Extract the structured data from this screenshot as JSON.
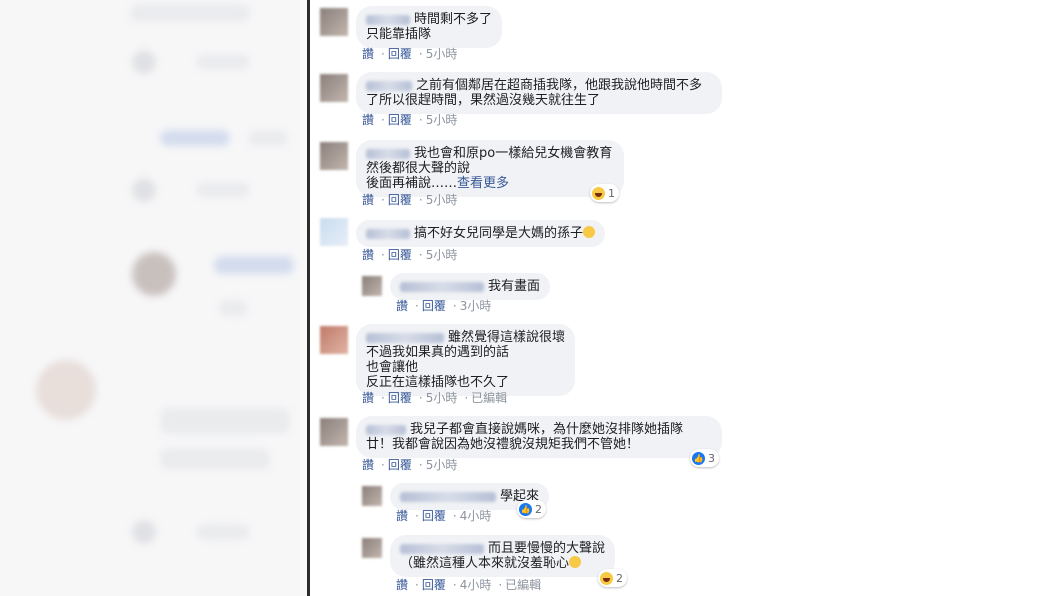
{
  "comments": [
    {
      "text_line1": "時間剩不多了",
      "text_rest": "只能靠插隊",
      "reply": "讚",
      "respond": "回覆",
      "time": "5小時"
    },
    {
      "text_line1": "之前有個鄰居在超商插我隊，他跟我說他時間不多",
      "text_rest": "了所以很趕時間，果然過沒幾天就往生了",
      "reply": "讚",
      "respond": "回覆",
      "time": "5小時"
    },
    {
      "text_line1": "我也會和原po一樣給兒女機會教育",
      "text_rest": "然後都很大聲的說\n後面再補說……",
      "see_more": "查看更多",
      "reaction_count": "1",
      "reply": "讚",
      "respond": "回覆",
      "time": "5小時"
    },
    {
      "text_line1": "搞不好女兒同學是大媽的孫子",
      "reply": "讚",
      "respond": "回覆",
      "time": "5小時"
    },
    {
      "text_line1": "我有畫面",
      "reply": "讚",
      "respond": "回覆",
      "time": "3小時"
    },
    {
      "text_line1": "雖然覺得這樣說很壞",
      "text_rest": "不過我如果真的遇到的話\n也會讓他\n反正在這樣插隊也不久了",
      "reply": "讚",
      "respond": "回覆",
      "time": "5小時",
      "edited": "已編輯"
    },
    {
      "text_line1": "我兒子都會直接說媽咪，為什麼她沒排隊她插隊",
      "text_rest": "廿！我都會說因為她沒禮貌沒規矩我們不管她！",
      "reaction_count": "3",
      "reply": "讚",
      "respond": "回覆",
      "time": "5小時"
    },
    {
      "text_line1": "學起來",
      "reaction_count": "2",
      "reply": "讚",
      "respond": "回覆",
      "time": "4小時"
    },
    {
      "text_line1": "而且要慢慢的大聲說",
      "text_rest": "（雖然這種人本來就沒羞恥心",
      "reaction_count": "2",
      "reply": "讚",
      "respond": "回覆",
      "time": "4小時",
      "edited": "已編輯"
    }
  ],
  "colors": {
    "link": "#385898",
    "bubble": "#f0f2f5",
    "like": "#1877f2",
    "haha": "#f7c945"
  }
}
